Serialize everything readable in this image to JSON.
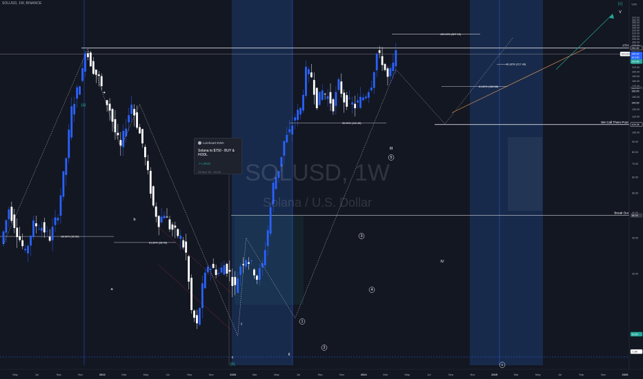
{
  "header": {
    "symbol_line": "SOLUSD, 1W, BINANCE"
  },
  "watermark": {
    "symbol": "SOLUSD, 1W",
    "name": "Solana / U.S. Dollar"
  },
  "idea_card": {
    "author": "Lionheart EWA",
    "title": "Solana to $750 - BUY & HODL",
    "position": "LONG",
    "date": "23 Nov '22 - 16:15"
  },
  "colors": {
    "background": "#131722",
    "candle_up": "#2962ff",
    "candle_down": "#ffffff",
    "wave_label": "#26a69a",
    "trend_arrow": "#26a69a",
    "support_line": "#f7a35c",
    "highlight_band": "#1e3a6e"
  },
  "chart_data": {
    "type": "candlestick",
    "timeframe": "1W",
    "y_axis": {
      "scale": "log",
      "currency": "USD",
      "range": [
        7.3,
        415
      ],
      "tick_labels": [
        "370.00",
        "360.00",
        "350.00",
        "340.00",
        "330.00",
        "320.00",
        "310.00",
        "300.00",
        "290.00",
        "280.00",
        "270.00",
        "260.00",
        "250.00",
        "240.00",
        "230.00",
        "220.00",
        "210.00",
        "200.00",
        "190.00",
        "180.00",
        "170.00",
        "160.00",
        "150.00",
        "140.00",
        "130.00",
        "120.00",
        "110.00",
        "100.00",
        "90.00",
        "80.00",
        "70.00",
        "60.00",
        "50.00",
        "40.00",
        "30.00",
        "20.00",
        "10.00"
      ],
      "price_tags": [
        {
          "label": "261.52",
          "value": 261.52
        },
        {
          "label": "244.42",
          "value": 244.42
        },
        {
          "label": "SOLUSD",
          "value": 244.42
        },
        {
          "label": "3d 13h",
          "value": 238.5
        },
        {
          "label": "240.85",
          "value": 240.85
        },
        {
          "label": "164.32",
          "value": 164.32
        },
        {
          "label": "160.00",
          "value": 160.0
        },
        {
          "label": "140.00",
          "value": 140.0
        },
        {
          "label": "109.28",
          "value": 109.28
        },
        {
          "label": "38.78",
          "value": 38.78
        },
        {
          "label": "10.00",
          "value": 10.0
        },
        {
          "label": "-1.80",
          "value": 8.2
        },
        {
          "label": "USD",
          "value": 415
        }
      ]
    },
    "x_axis": {
      "labels": [
        "May",
        "Jul",
        "Sep",
        "Nov",
        "2022",
        "Mar",
        "May",
        "Jul",
        "Sep",
        "Nov",
        "2023",
        "Mar",
        "May",
        "Jul",
        "Sep",
        "Nov",
        "2024",
        "Mar",
        "May",
        "Jul",
        "Sep",
        "Nov",
        "2025",
        "Mar",
        "May",
        "Jul",
        "Sep",
        "Nov",
        "2026"
      ],
      "start": "2021-04",
      "end": "2026-01"
    },
    "ohlc_weekly_close_path": [
      {
        "t": 0,
        "v": 28
      },
      {
        "t": 3,
        "v": 42
      },
      {
        "t": 6,
        "v": 32
      },
      {
        "t": 9,
        "v": 25
      },
      {
        "t": 12,
        "v": 35
      },
      {
        "t": 15,
        "v": 34
      },
      {
        "t": 18,
        "v": 30
      },
      {
        "t": 21,
        "v": 40
      },
      {
        "t": 24,
        "v": 75
      },
      {
        "t": 26,
        "v": 130
      },
      {
        "t": 28,
        "v": 160
      },
      {
        "t": 30,
        "v": 200
      },
      {
        "t": 31,
        "v": 260
      },
      {
        "t": 32,
        "v": 240
      },
      {
        "t": 34,
        "v": 205
      },
      {
        "t": 36,
        "v": 185
      },
      {
        "t": 38,
        "v": 150
      },
      {
        "t": 40,
        "v": 130
      },
      {
        "t": 42,
        "v": 100
      },
      {
        "t": 44,
        "v": 84
      },
      {
        "t": 46,
        "v": 110
      },
      {
        "t": 48,
        "v": 138
      },
      {
        "t": 50,
        "v": 110
      },
      {
        "t": 52,
        "v": 88
      },
      {
        "t": 54,
        "v": 62
      },
      {
        "t": 56,
        "v": 43
      },
      {
        "t": 58,
        "v": 36
      },
      {
        "t": 60,
        "v": 40
      },
      {
        "t": 62,
        "v": 34
      },
      {
        "t": 64,
        "v": 32
      },
      {
        "t": 66,
        "v": 30
      },
      {
        "t": 68,
        "v": 25
      },
      {
        "t": 70,
        "v": 13
      },
      {
        "t": 72,
        "v": 11
      },
      {
        "t": 74,
        "v": 17
      },
      {
        "t": 76,
        "v": 22
      },
      {
        "t": 78,
        "v": 21
      },
      {
        "t": 80,
        "v": 20
      },
      {
        "t": 82,
        "v": 22
      },
      {
        "t": 84,
        "v": 20
      },
      {
        "t": 86,
        "v": 17
      },
      {
        "t": 88,
        "v": 22
      },
      {
        "t": 90,
        "v": 24
      },
      {
        "t": 92,
        "v": 22
      },
      {
        "t": 94,
        "v": 19
      },
      {
        "t": 96,
        "v": 22
      },
      {
        "t": 98,
        "v": 33
      },
      {
        "t": 100,
        "v": 55
      },
      {
        "t": 102,
        "v": 66
      },
      {
        "t": 104,
        "v": 90
      },
      {
        "t": 106,
        "v": 100
      },
      {
        "t": 108,
        "v": 120
      },
      {
        "t": 110,
        "v": 130
      },
      {
        "t": 112,
        "v": 200
      },
      {
        "t": 114,
        "v": 190
      },
      {
        "t": 116,
        "v": 140
      },
      {
        "t": 118,
        "v": 160
      },
      {
        "t": 120,
        "v": 150
      },
      {
        "t": 122,
        "v": 135
      },
      {
        "t": 124,
        "v": 175
      },
      {
        "t": 126,
        "v": 145
      },
      {
        "t": 128,
        "v": 140
      },
      {
        "t": 130,
        "v": 135
      },
      {
        "t": 132,
        "v": 145
      },
      {
        "t": 134,
        "v": 155
      },
      {
        "t": 136,
        "v": 175
      },
      {
        "t": 138,
        "v": 245
      },
      {
        "t": 140,
        "v": 225
      },
      {
        "t": 142,
        "v": 185
      },
      {
        "t": 144,
        "v": 215
      },
      {
        "t": 145,
        "v": 244.42
      }
    ],
    "horizontal_levels": [
      {
        "label": "ATH",
        "value": 261.52
      },
      {
        "label": "We Call Them Poor",
        "value": 109.28
      },
      {
        "label": "Break Out",
        "value": 38.78
      },
      {
        "label": "100.00% (307.10)",
        "value": 307.1
      },
      {
        "label": "61.80% (217.49)",
        "value": 217.49
      },
      {
        "label": "61.80% (168.88)",
        "value": 168.88
      },
      {
        "label": "50.00% (111.43)",
        "value": 111.43
      },
      {
        "label": "88.60% (30.50)",
        "value": 30.5
      },
      {
        "label": "61.80% (28.46)",
        "value": 28.46
      }
    ],
    "wave_labels": [
      {
        "label": "(a)",
        "t": 31,
        "v": 285
      },
      {
        "label": "a",
        "t": 43,
        "v": 72
      },
      {
        "label": "b",
        "t": 50,
        "v": 155
      },
      {
        "label": "c",
        "t": 86,
        "v": 8.6
      },
      {
        "label": "(b)",
        "t": 86,
        "v": 7.7
      },
      {
        "label": "I",
        "t": 89,
        "v": 36
      },
      {
        "label": "II",
        "t": 107,
        "v": 8.8
      },
      {
        "label": "1",
        "t": 111,
        "v": 37
      },
      {
        "label": "2",
        "t": 120,
        "v": 17
      },
      {
        "label": "3",
        "t": 134,
        "v": 130
      },
      {
        "label": "4",
        "t": 137,
        "v": 79
      },
      {
        "label": "5",
        "t": 144,
        "v": 222
      },
      {
        "label": "III",
        "t": 144,
        "v": 235
      },
      {
        "label": "IV",
        "t": 162,
        "v": 99
      },
      {
        "label": "(c)",
        "t": 229,
        "v": 400
      },
      {
        "label": "V",
        "t": 229,
        "v": 380
      },
      {
        "label": "c",
        "t": 185,
        "v": 7.5
      }
    ]
  }
}
